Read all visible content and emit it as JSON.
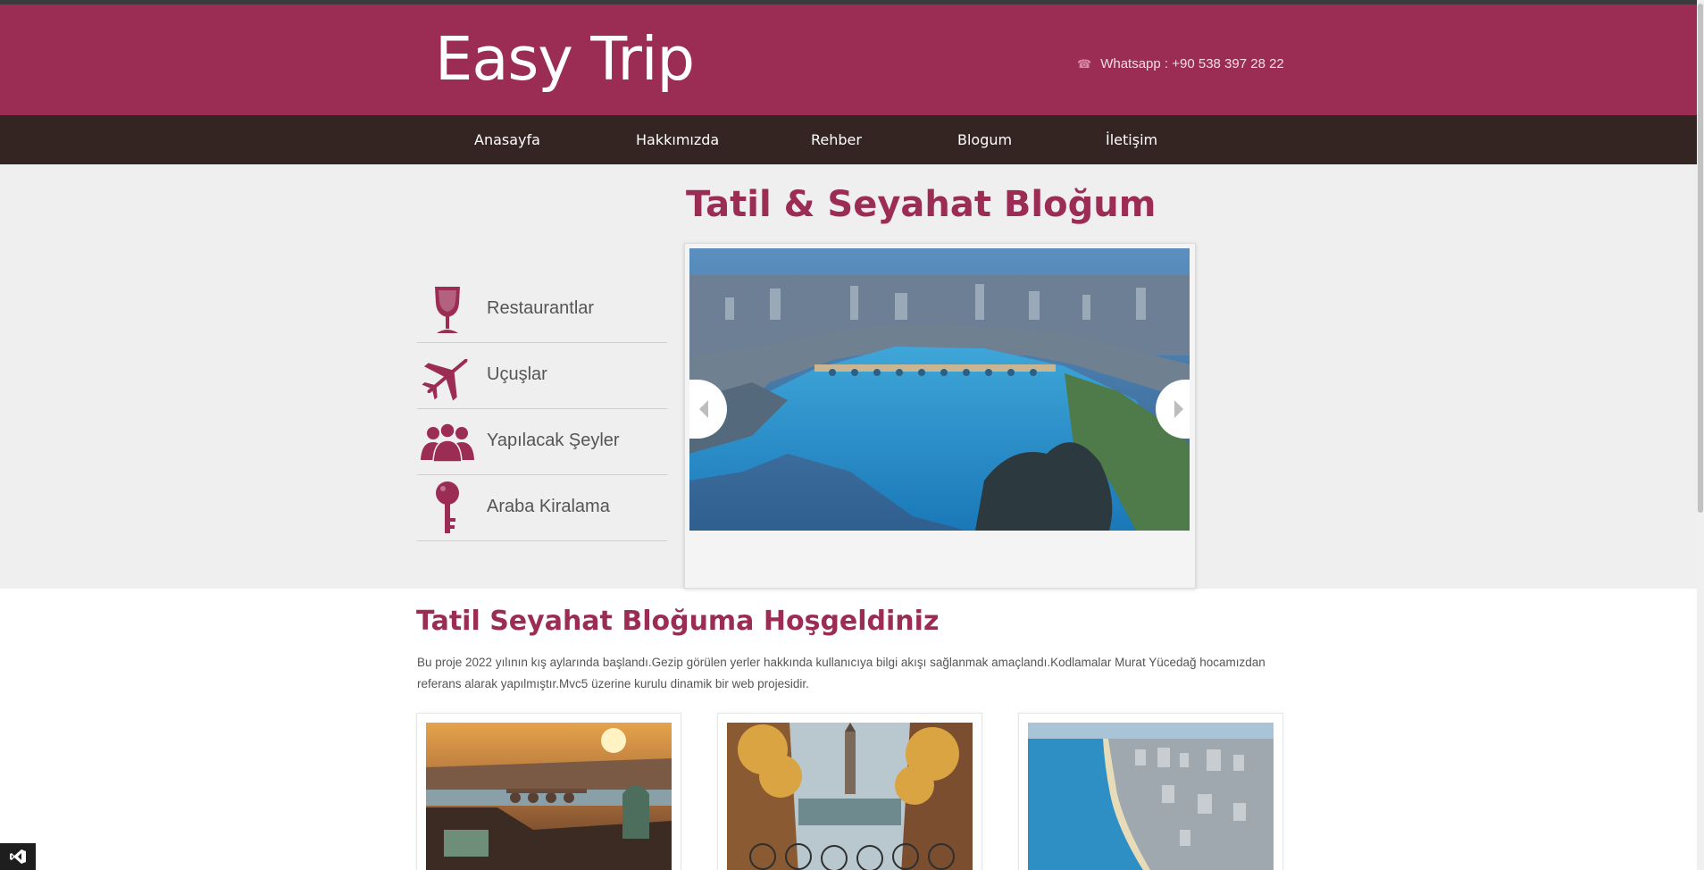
{
  "header": {
    "logo": "Easy Trip",
    "whatsapp": "Whatsapp : +90 538 397 28 22",
    "phone_icon": "phone-icon"
  },
  "nav": {
    "items": [
      {
        "label": "Anasayfa"
      },
      {
        "label": "Hakkımızda"
      },
      {
        "label": "Rehber"
      },
      {
        "label": "Blogum"
      },
      {
        "label": "İletişim"
      }
    ]
  },
  "hero": {
    "title": "Tatil & Seyahat Bloğum",
    "side_items": [
      {
        "label": "Restaurantlar",
        "icon": "wine-glass-icon"
      },
      {
        "label": "Uçuşlar",
        "icon": "airplane-icon"
      },
      {
        "label": "Yapılacak Şeyler",
        "icon": "people-icon"
      },
      {
        "label": "Araba Kiralama",
        "icon": "key-icon"
      }
    ]
  },
  "welcome": {
    "title": "Tatil Seyahat Bloğuma Hoşgeldiniz",
    "text": "Bu proje 2022 yılının kış aylarında başlandı.Gezip görülen yerler hakkında kullanıcıya bilgi akışı sağlanmak amaçlandı.Kodlamalar Murat Yücedağ hocamızdan referans alarak yapılmıştır.Mvc5 üzerine kurulu dinamik bir web projesidir."
  },
  "colors": {
    "brand": "#9b2d55",
    "nav_bg": "#352522",
    "hero_bg": "#efefef"
  }
}
